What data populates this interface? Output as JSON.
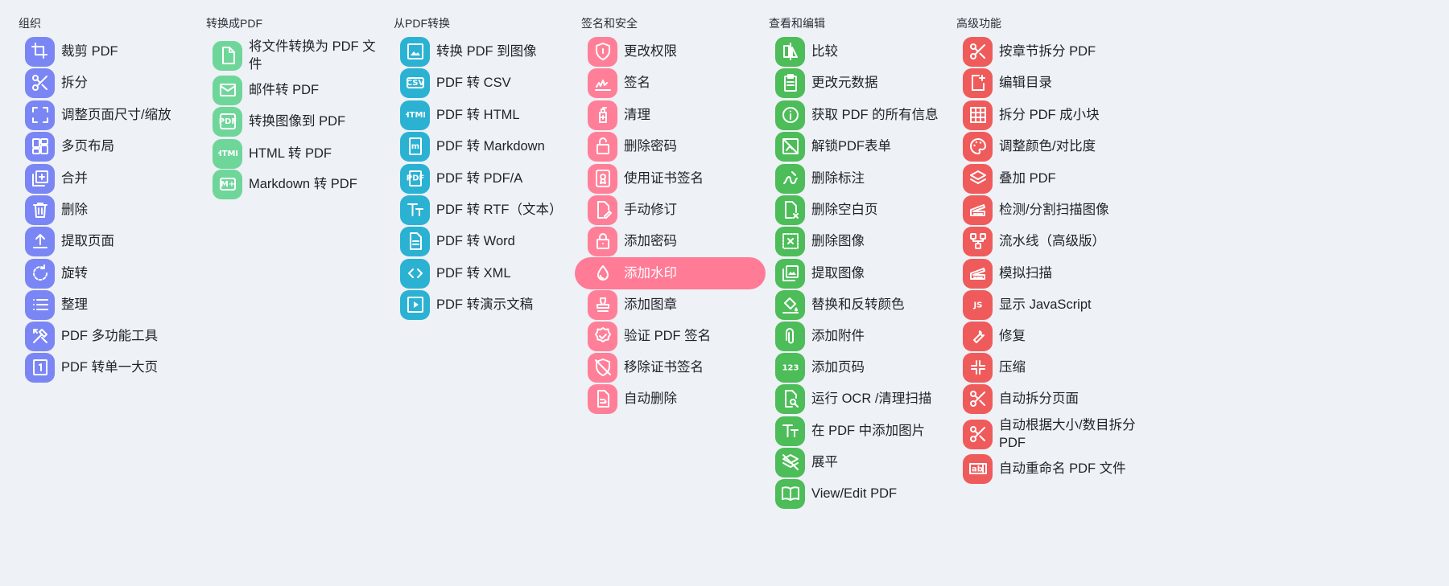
{
  "colors": {
    "organize": "#7b86f5",
    "convert_to": "#6fd69a",
    "convert_from": "#2bb2d3",
    "security": "#ff7f98",
    "edit": "#4cbd58",
    "advanced": "#ef5b5b",
    "active_bg": "#ff7b96"
  },
  "columns": [
    {
      "key": "organize",
      "title": "组织",
      "items": [
        {
          "label": "裁剪 PDF",
          "icon": "crop-icon"
        },
        {
          "label": "拆分",
          "icon": "scissors-icon"
        },
        {
          "label": "调整页面尺寸/缩放",
          "icon": "fullscreen-icon"
        },
        {
          "label": "多页布局",
          "icon": "dashboard-icon"
        },
        {
          "label": "合并",
          "icon": "add-to-photos-icon"
        },
        {
          "label": "删除",
          "icon": "trash-icon"
        },
        {
          "label": "提取页面",
          "icon": "upload-icon"
        },
        {
          "label": "旋转",
          "icon": "rotate-icon"
        },
        {
          "label": "整理",
          "icon": "list-icon"
        },
        {
          "label": "PDF 多功能工具",
          "icon": "tools-icon"
        },
        {
          "label": "PDF 转单一大页",
          "icon": "page-one-icon"
        }
      ]
    },
    {
      "key": "convert_to",
      "title": "转换成PDF",
      "items": [
        {
          "label": "将文件转换为 PDF 文件",
          "icon": "file-icon"
        },
        {
          "label": "邮件转 PDF",
          "icon": "mail-icon"
        },
        {
          "label": "转换图像到 PDF",
          "icon": "pdf-image-icon"
        },
        {
          "label": "HTML 转 PDF",
          "icon": "html-icon"
        },
        {
          "label": "Markdown 转 PDF",
          "icon": "markdown-icon"
        }
      ]
    },
    {
      "key": "convert_from",
      "title": "从PDF转换",
      "items": [
        {
          "label": "转换 PDF 到图像",
          "icon": "image-icon"
        },
        {
          "label": "PDF 转 CSV",
          "icon": "csv-icon"
        },
        {
          "label": "PDF 转 HTML",
          "icon": "html-icon"
        },
        {
          "label": "PDF 转 Markdown",
          "icon": "markdown-doc-icon"
        },
        {
          "label": "PDF 转 PDF/A",
          "icon": "pdfa-icon"
        },
        {
          "label": "PDF 转 RTF（文本）",
          "icon": "text-fields-icon"
        },
        {
          "label": "PDF 转 Word",
          "icon": "document-icon"
        },
        {
          "label": "PDF 转 XML",
          "icon": "code-icon"
        },
        {
          "label": "PDF 转演示文稿",
          "icon": "slideshow-icon"
        }
      ]
    },
    {
      "key": "security",
      "title": "签名和安全",
      "items": [
        {
          "label": "更改权限",
          "icon": "shield-icon"
        },
        {
          "label": "签名",
          "icon": "signature-icon"
        },
        {
          "label": "清理",
          "icon": "sanitize-icon"
        },
        {
          "label": "删除密码",
          "icon": "unlock-icon"
        },
        {
          "label": "使用证书签名",
          "icon": "certificate-icon"
        },
        {
          "label": "手动修订",
          "icon": "edit-document-icon"
        },
        {
          "label": "添加密码",
          "icon": "lock-icon"
        },
        {
          "label": "添加水印",
          "icon": "water-drop-icon",
          "active": true
        },
        {
          "label": "添加图章",
          "icon": "stamp-icon"
        },
        {
          "label": "验证 PDF 签名",
          "icon": "verified-icon"
        },
        {
          "label": "移除证书签名",
          "icon": "remove-shield-icon"
        },
        {
          "label": "自动删除",
          "icon": "auto-redact-icon"
        }
      ]
    },
    {
      "key": "edit",
      "title": "查看和编辑",
      "items": [
        {
          "label": "比较",
          "icon": "compare-icon"
        },
        {
          "label": "更改元数据",
          "icon": "clipboard-icon"
        },
        {
          "label": "获取 PDF 的所有信息",
          "icon": "info-icon"
        },
        {
          "label": "解锁PDF表单",
          "icon": "no-image-icon"
        },
        {
          "label": "删除标注",
          "icon": "ink-eraser-icon"
        },
        {
          "label": "删除空白页",
          "icon": "blank-page-icon"
        },
        {
          "label": "删除图像",
          "icon": "hide-image-icon"
        },
        {
          "label": "提取图像",
          "icon": "photo-library-icon"
        },
        {
          "label": "替换和反转颜色",
          "icon": "format-color-fill-icon"
        },
        {
          "label": "添加附件",
          "icon": "attachment-icon"
        },
        {
          "label": "添加页码",
          "icon": "numbers-icon"
        },
        {
          "label": "运行 OCR /清理扫描",
          "icon": "document-search-icon"
        },
        {
          "label": "在 PDF 中添加图片",
          "icon": "text-fields-icon"
        },
        {
          "label": "展平",
          "icon": "layers-clear-icon"
        },
        {
          "label": "View/Edit PDF",
          "icon": "book-icon"
        }
      ]
    },
    {
      "key": "advanced",
      "title": "高级功能",
      "items": [
        {
          "label": "按章节拆分 PDF",
          "icon": "scissors-icon"
        },
        {
          "label": "编辑目录",
          "icon": "edit-toc-icon"
        },
        {
          "label": "拆分 PDF 成小块",
          "icon": "grid-icon"
        },
        {
          "label": "调整颜色/对比度",
          "icon": "palette-icon"
        },
        {
          "label": "叠加 PDF",
          "icon": "layers-icon"
        },
        {
          "label": "检测/分割扫描图像",
          "icon": "scanner-icon"
        },
        {
          "label": "流水线（高级版）",
          "icon": "pipeline-icon"
        },
        {
          "label": "模拟扫描",
          "icon": "scanner-icon"
        },
        {
          "label": "显示 JavaScript",
          "icon": "javascript-icon"
        },
        {
          "label": "修复",
          "icon": "build-icon"
        },
        {
          "label": "压缩",
          "icon": "compress-icon"
        },
        {
          "label": "自动拆分页面",
          "icon": "scissors-icon"
        },
        {
          "label": "自动根据大小/数目拆分 PDF",
          "icon": "scissors-icon"
        },
        {
          "label": "自动重命名 PDF 文件",
          "icon": "rename-icon"
        }
      ]
    }
  ]
}
